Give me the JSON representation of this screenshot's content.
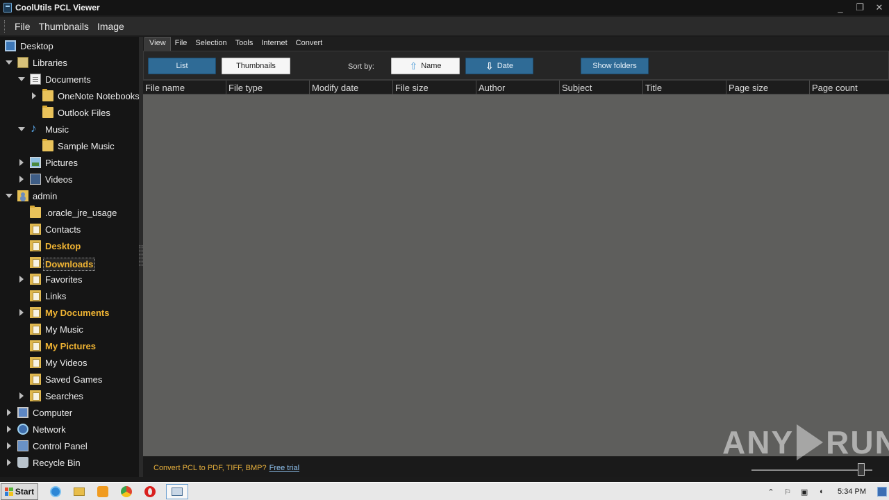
{
  "window": {
    "title": "CoolUtils PCL Viewer",
    "controls": [
      "_",
      "❐",
      "✕"
    ]
  },
  "menubar": [
    "File",
    "Thumbnails",
    "Image"
  ],
  "tree": [
    {
      "label": "Desktop",
      "level": 0,
      "expander": "none",
      "icon": "desktop-icon",
      "style": "normal"
    },
    {
      "label": "Libraries",
      "level": 0,
      "expander": "expanded",
      "icon": "libraries-icon",
      "style": "normal"
    },
    {
      "label": "Documents",
      "level": 1,
      "expander": "expanded",
      "icon": "documents-icon",
      "style": "normal"
    },
    {
      "label": "OneNote Notebooks",
      "level": 2,
      "expander": "collapsed",
      "icon": "folder-icon",
      "style": "normal"
    },
    {
      "label": "Outlook Files",
      "level": 2,
      "expander": "none",
      "icon": "folder-icon",
      "style": "normal"
    },
    {
      "label": "Music",
      "level": 1,
      "expander": "expanded",
      "icon": "music-icon",
      "style": "normal"
    },
    {
      "label": "Sample Music",
      "level": 2,
      "expander": "none",
      "icon": "folder-icon",
      "style": "normal"
    },
    {
      "label": "Pictures",
      "level": 1,
      "expander": "collapsed",
      "icon": "pictures-icon",
      "style": "normal"
    },
    {
      "label": "Videos",
      "level": 1,
      "expander": "collapsed",
      "icon": "videos-icon",
      "style": "normal"
    },
    {
      "label": "admin",
      "level": 0,
      "expander": "expanded",
      "icon": "user-folder-icon",
      "style": "normal"
    },
    {
      "label": ".oracle_jre_usage",
      "level": 1,
      "expander": "none",
      "icon": "folder-icon",
      "style": "normal"
    },
    {
      "label": "Contacts",
      "level": 1,
      "expander": "none",
      "icon": "contacts-folder-icon",
      "style": "normal"
    },
    {
      "label": "Desktop",
      "level": 1,
      "expander": "none",
      "icon": "desktop-folder-icon",
      "style": "bold"
    },
    {
      "label": "Downloads",
      "level": 1,
      "expander": "none",
      "icon": "downloads-folder-icon",
      "style": "selected"
    },
    {
      "label": "Favorites",
      "level": 1,
      "expander": "collapsed",
      "icon": "favorites-folder-icon",
      "style": "normal"
    },
    {
      "label": "Links",
      "level": 1,
      "expander": "none",
      "icon": "links-folder-icon",
      "style": "normal"
    },
    {
      "label": "My Documents",
      "level": 1,
      "expander": "collapsed",
      "icon": "documents-folder-icon",
      "style": "bold"
    },
    {
      "label": "My Music",
      "level": 1,
      "expander": "none",
      "icon": "music-folder-icon",
      "style": "normal"
    },
    {
      "label": "My Pictures",
      "level": 1,
      "expander": "none",
      "icon": "pictures-folder-icon",
      "style": "bold"
    },
    {
      "label": "My Videos",
      "level": 1,
      "expander": "none",
      "icon": "videos-folder-icon",
      "style": "normal"
    },
    {
      "label": "Saved Games",
      "level": 1,
      "expander": "none",
      "icon": "saved-games-folder-icon",
      "style": "normal"
    },
    {
      "label": "Searches",
      "level": 1,
      "expander": "collapsed",
      "icon": "searches-folder-icon",
      "style": "normal"
    },
    {
      "label": "Computer",
      "level": 0,
      "expander": "collapsed",
      "icon": "computer-icon",
      "style": "normal"
    },
    {
      "label": "Network",
      "level": 0,
      "expander": "collapsed",
      "icon": "network-icon",
      "style": "normal"
    },
    {
      "label": "Control Panel",
      "level": 0,
      "expander": "collapsed",
      "icon": "control-panel-icon",
      "style": "normal"
    },
    {
      "label": "Recycle Bin",
      "level": 0,
      "expander": "collapsed",
      "icon": "recycle-bin-icon",
      "style": "normal"
    }
  ],
  "tabs": [
    "View",
    "File",
    "Selection",
    "Tools",
    "Internet",
    "Convert"
  ],
  "active_tab": "View",
  "toolbar": {
    "list_label": "List",
    "thumbnails_label": "Thumbnails",
    "sort_by_label": "Sort by:",
    "sort_name_label": "Name",
    "sort_date_label": "Date",
    "show_folders_label": "Show folders"
  },
  "columns": [
    "File name",
    "File type",
    "Modify date",
    "File size",
    "Author",
    "Subject",
    "Title",
    "Page size",
    "Page count"
  ],
  "footer": {
    "promo_text": "Convert PCL to PDF, TIFF, BMP?",
    "promo_link": "Free trial"
  },
  "watermark": {
    "left": "ANY",
    "right": "RUN"
  },
  "taskbar": {
    "start_label": "Start",
    "clock": "5:34 PM"
  },
  "colors": {
    "accent_blue": "#2f6b96",
    "bold_folder_text": "#f0b433",
    "promo_text": "#e8b13d",
    "grid_background": "#5e5e5c"
  }
}
